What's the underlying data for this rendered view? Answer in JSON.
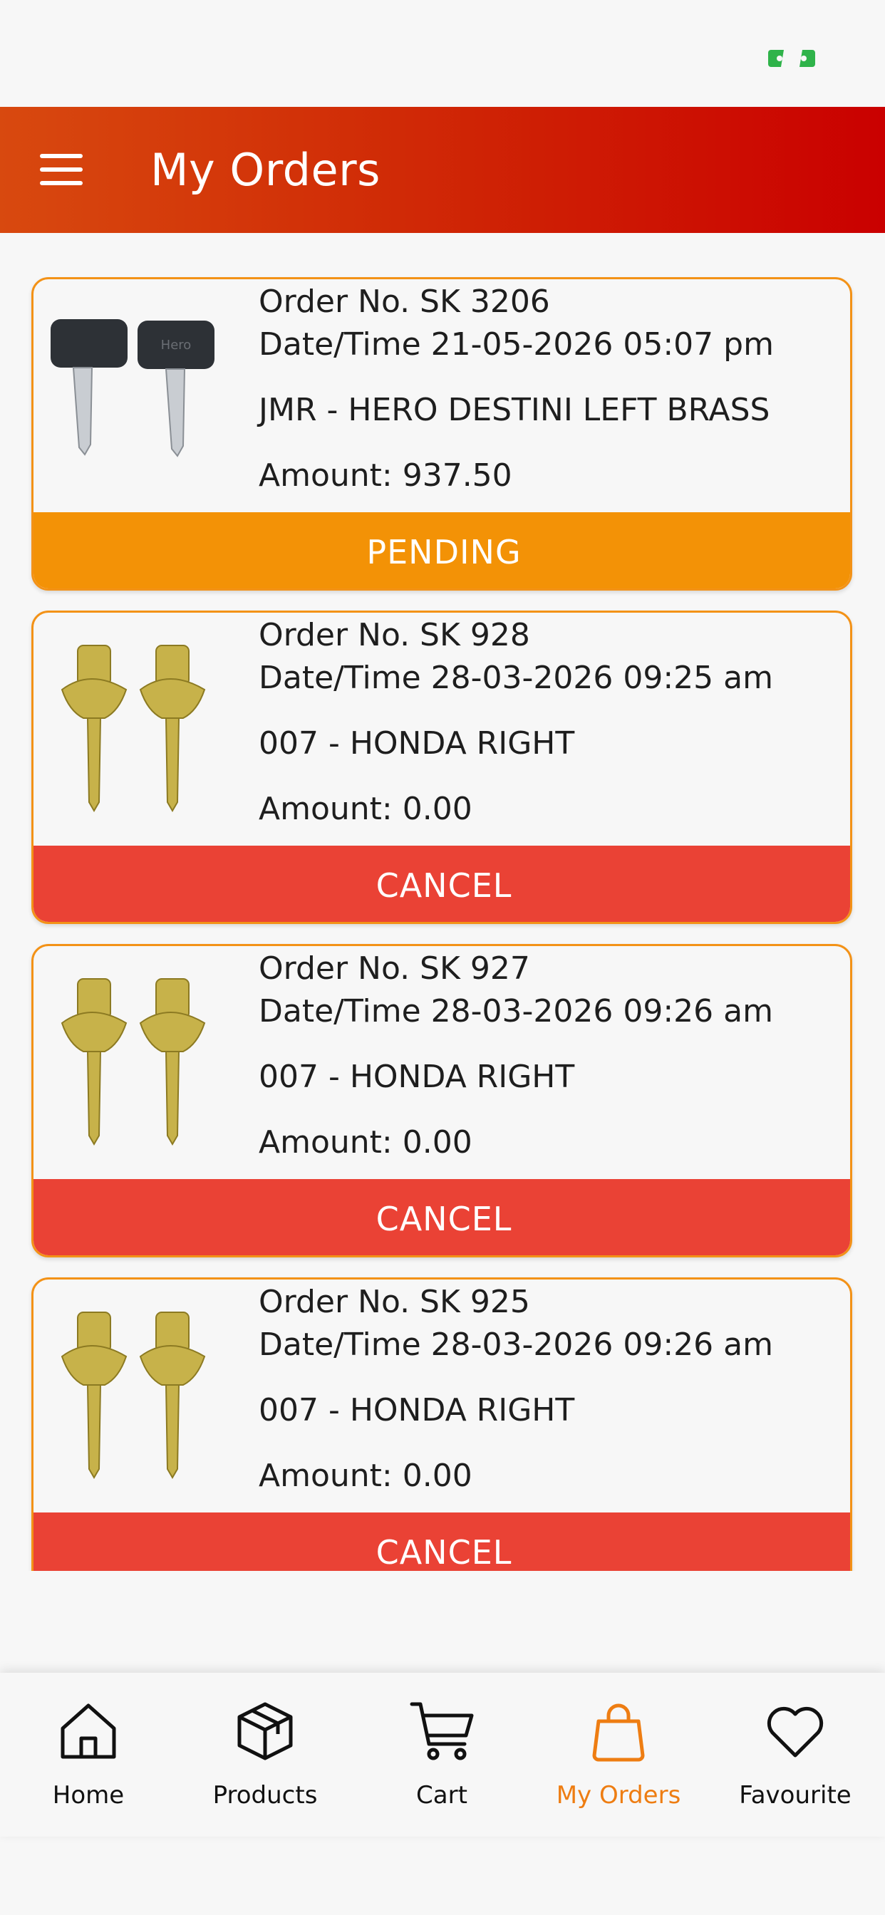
{
  "header": {
    "title": "My Orders"
  },
  "orders": [
    {
      "order_no": "Order No. SK 3206",
      "datetime": "Date/Time 21-05-2026 05:07 pm",
      "product": "JMR - HERO DESTINI LEFT BRASS",
      "amount": "Amount: 937.50",
      "status": "PENDING",
      "status_color": "#f39206",
      "image": "black-key-pair",
      "key_text": "Hero"
    },
    {
      "order_no": "Order No. SK 928",
      "datetime": "Date/Time 28-03-2026 09:25 am",
      "product": "007 - HONDA RIGHT",
      "amount": "Amount: 0.00",
      "status": "CANCEL",
      "status_color": "#ea4235",
      "image": "brass-key-pair"
    },
    {
      "order_no": "Order No. SK 927",
      "datetime": "Date/Time 28-03-2026 09:26 am",
      "product": "007 - HONDA RIGHT",
      "amount": "Amount: 0.00",
      "status": "CANCEL",
      "status_color": "#ea4235",
      "image": "brass-key-pair"
    },
    {
      "order_no": "Order No. SK 925",
      "datetime": "Date/Time 28-03-2026 09:26 am",
      "product": "007 - HONDA RIGHT",
      "amount": "Amount: 0.00",
      "status": "CANCEL",
      "status_color": "#ea4235",
      "image": "brass-key-pair"
    }
  ],
  "nav": {
    "items": [
      {
        "label": "Home",
        "icon": "home-icon"
      },
      {
        "label": "Products",
        "icon": "box-icon"
      },
      {
        "label": "Cart",
        "icon": "cart-icon"
      },
      {
        "label": "My Orders",
        "icon": "shopping-bag-icon",
        "active": true
      },
      {
        "label": "Favourite",
        "icon": "heart-icon"
      }
    ]
  },
  "colors": {
    "accent": "#ee7d12",
    "header_start": "#d8490f",
    "header_end": "#ca0000",
    "pending": "#f39206",
    "cancel": "#ea4235",
    "card_border": "#f39217"
  }
}
